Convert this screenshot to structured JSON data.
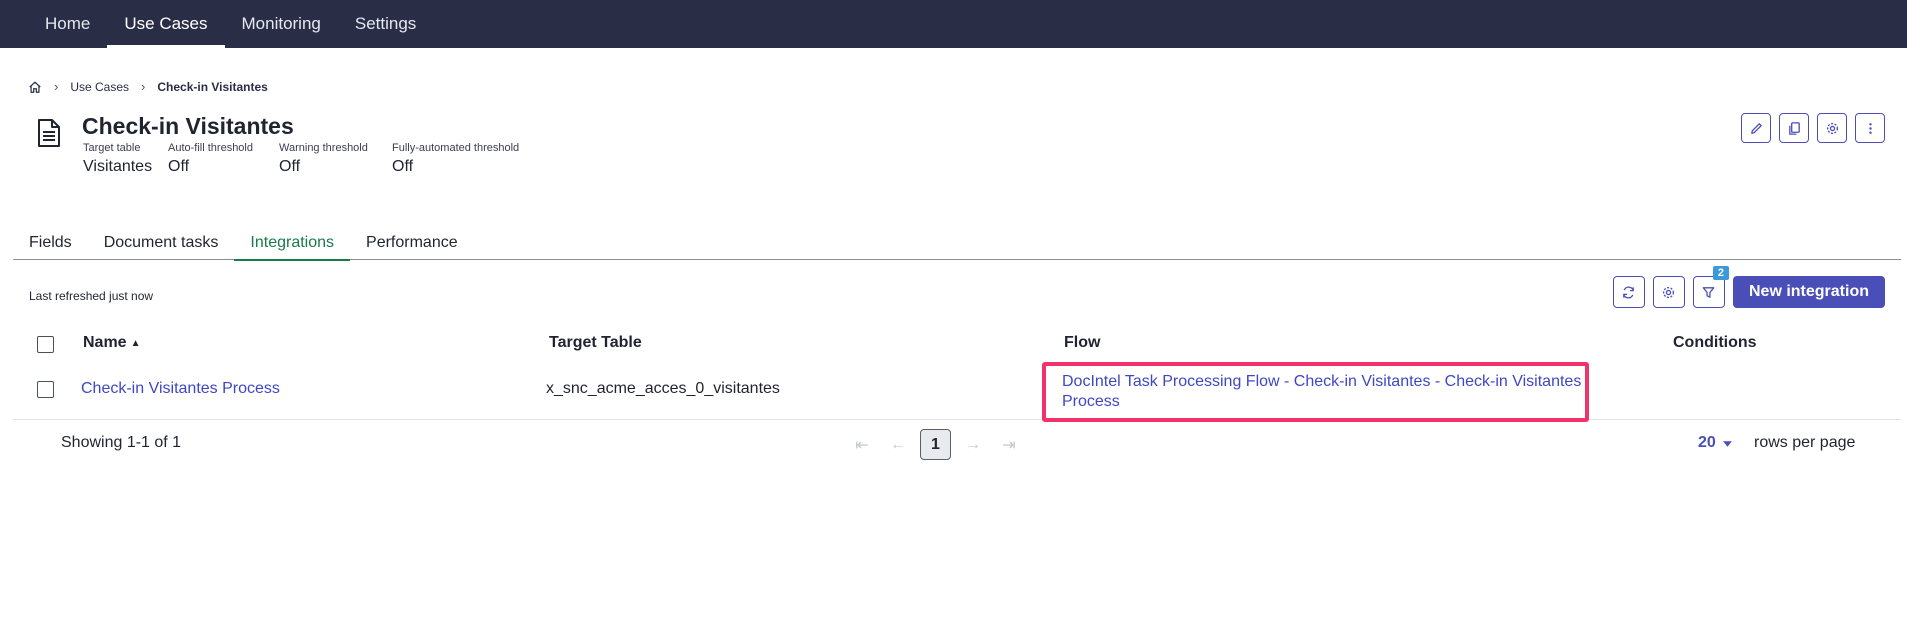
{
  "topnav": {
    "items": [
      {
        "label": "Home",
        "active": false
      },
      {
        "label": "Use Cases",
        "active": true
      },
      {
        "label": "Monitoring",
        "active": false
      },
      {
        "label": "Settings",
        "active": false
      }
    ]
  },
  "breadcrumb": {
    "items": [
      "Use Cases",
      "Check-in Visitantes"
    ]
  },
  "header": {
    "title": "Check-in Visitantes",
    "meta": [
      {
        "label": "Target table",
        "value": "Visitantes"
      },
      {
        "label": "Auto-fill threshold",
        "value": "Off"
      },
      {
        "label": "Warning threshold",
        "value": "Off"
      },
      {
        "label": "Fully-automated threshold",
        "value": "Off"
      }
    ],
    "actions": [
      "edit-icon",
      "copy-icon",
      "gear-icon",
      "more-vertical-icon"
    ]
  },
  "tabs": [
    {
      "label": "Fields",
      "active": false
    },
    {
      "label": "Document tasks",
      "active": false
    },
    {
      "label": "Integrations",
      "active": true
    },
    {
      "label": "Performance",
      "active": false
    }
  ],
  "toolbar": {
    "refreshed_text": "Last refreshed just now",
    "filter_count": "2",
    "new_integration_label": "New integration"
  },
  "table": {
    "columns": [
      "Name",
      "Target Table",
      "Flow",
      "Conditions"
    ],
    "sort_indicator": "▲",
    "rows": [
      {
        "name": "Check-in Visitantes Process",
        "target_table": "x_snc_acme_acces_0_visitantes",
        "flow": "DocIntel Task Processing Flow - Check-in Visitantes - Check-in Visitantes Process",
        "conditions": ""
      }
    ]
  },
  "pagination": {
    "showing": "Showing 1-1 of 1",
    "current_page": "1",
    "rows_per_page_value": "20",
    "rows_per_page_label": "rows per page"
  },
  "colors": {
    "nav_bg": "#2a2d46",
    "accent": "#4a4fb8",
    "link": "#3f47c4",
    "active_tab": "#1a7a4a",
    "highlight": "#f0336a"
  }
}
